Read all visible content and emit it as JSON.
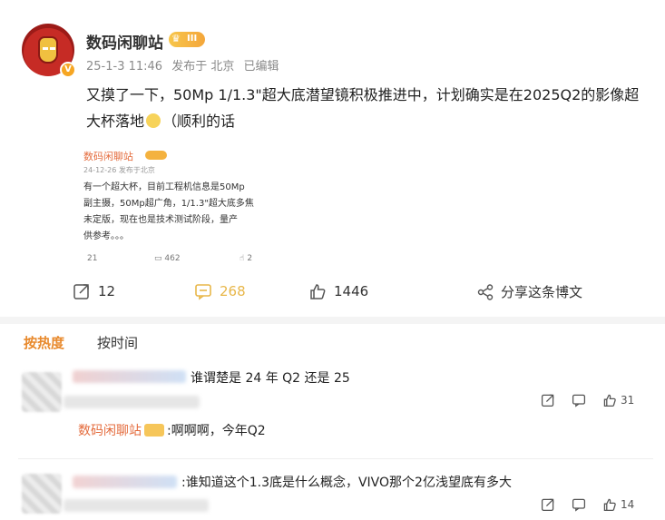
{
  "post": {
    "username": "数码闲聊站",
    "vip_label": "III",
    "timestamp": "25-1-3 11:46",
    "source": "发布于 北京",
    "edited": "已编辑",
    "text_main": "又摸了一下，50Mp 1/1.3\"超大底潜望镜积极推进中，计划确实是在2025Q2的影像超大杯落地",
    "text_tail": "（顺利的话"
  },
  "quoted": {
    "username": "数码闲聊站",
    "date": "24-12-26 发布于北京",
    "lines": [
      "有一个超大杯，目前工程机信息是50Mp",
      "副主摄，50Mp超广角，1/1.3\"超大底多焦",
      "未定版，现在也是技术测试阶段，量产",
      "供参考。。。"
    ],
    "reposts": "21",
    "comments": "462",
    "likes": "2"
  },
  "actions": {
    "reposts": "12",
    "comments": "268",
    "likes": "1446",
    "share": "分享这条博文"
  },
  "sort_tabs": {
    "hot": "按热度",
    "time": "按时间"
  },
  "comments": [
    {
      "text": "谁谓楚是 24 年 Q2 还是 25",
      "likes": "31",
      "reply": {
        "username": "数码闲聊站",
        "text": ":啊啊啊，今年Q2"
      }
    },
    {
      "text": ":谁知道这个1.3底是什么概念，VIVO那个2亿浅望底有多大",
      "likes": "14"
    }
  ],
  "colors": {
    "accent_orange": "#e8892c",
    "comment_gold": "#e8b74a",
    "reply_name": "#e46b3c"
  },
  "icons": [
    "repost-icon",
    "comment-icon",
    "like-icon",
    "share-icon"
  ]
}
